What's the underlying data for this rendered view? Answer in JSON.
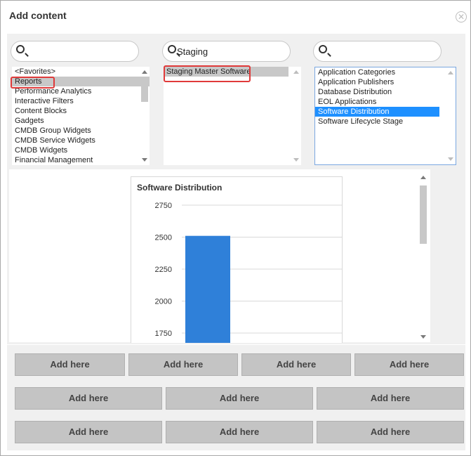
{
  "dialog": {
    "title": "Add content",
    "close_icon": "close-icon"
  },
  "columns": [
    {
      "search_value": "",
      "items": [
        "<Favorites>",
        "Reports",
        "Performance Analytics",
        "Interactive Filters",
        "Content Blocks",
        "Gadgets",
        "CMDB Group Widgets",
        "CMDB Service Widgets",
        "CMDB Widgets",
        "Financial Management"
      ],
      "selected": "Reports"
    },
    {
      "search_value": "Staging",
      "items": [
        "Staging Master Software"
      ],
      "selected": "Staging Master Software"
    },
    {
      "search_value": "",
      "items": [
        "Application Categories",
        "Application Publishers",
        "Database Distribution",
        "EOL Applications",
        "Software Distribution",
        "Software Lifecycle Stage"
      ],
      "selected": "Software Distribution"
    }
  ],
  "chart_data": {
    "type": "bar",
    "title": "Software Distribution",
    "y_ticks": [
      2750,
      2500,
      2250,
      2000,
      1750
    ],
    "ylim": [
      1750,
      2750
    ],
    "values": [
      2510
    ],
    "grid": true,
    "bar_color": "#2f80d9"
  },
  "drop_zones": {
    "row1": [
      "Add here",
      "Add here",
      "Add here",
      "Add here"
    ],
    "row2": [
      "Add here",
      "Add here",
      "Add here"
    ],
    "row3": [
      "Add here",
      "Add here",
      "Add here"
    ]
  },
  "colors": {
    "highlight_box": "#e03a3a",
    "selection_blue": "#1e90ff",
    "selection_gray": "#c8c8c8"
  }
}
